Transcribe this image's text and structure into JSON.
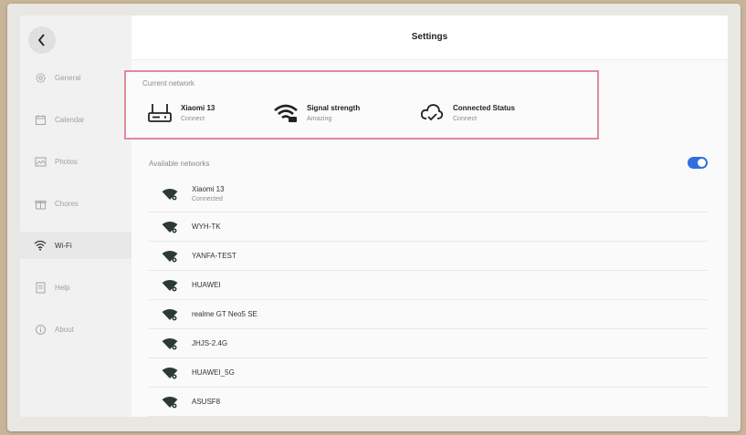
{
  "header": {
    "title": "Settings"
  },
  "sidebar": {
    "items": [
      {
        "label": "General",
        "icon": "gear-icon",
        "active": false
      },
      {
        "label": "Calendar",
        "icon": "calendar-icon",
        "active": false
      },
      {
        "label": "Photos",
        "icon": "photo-icon",
        "active": false
      },
      {
        "label": "Chores",
        "icon": "gift-icon",
        "active": false
      },
      {
        "label": "Wi-Fi",
        "icon": "wifi-icon",
        "active": true
      },
      {
        "label": "Help",
        "icon": "document-icon",
        "active": false
      },
      {
        "label": "About",
        "icon": "info-icon",
        "active": false
      }
    ]
  },
  "current_network": {
    "label": "Current network",
    "items": [
      {
        "title": "Xiaomi 13",
        "subtitle": "Connect",
        "icon": "router-icon"
      },
      {
        "title": "Signal strength",
        "subtitle": "Amazing",
        "icon": "wifi-signal-icon"
      },
      {
        "title": "Connected Status",
        "subtitle": "Connect",
        "icon": "cloud-check-icon"
      }
    ]
  },
  "available": {
    "label": "Available networks",
    "toggle_on": true,
    "networks": [
      {
        "name": "Xiaomi 13",
        "status": "Connected"
      },
      {
        "name": "WYH-TK",
        "status": ""
      },
      {
        "name": "YANFA-TEST",
        "status": ""
      },
      {
        "name": "HUAWEI",
        "status": ""
      },
      {
        "name": "realme GT Neo5 SE",
        "status": ""
      },
      {
        "name": "JHJS-2.4G",
        "status": ""
      },
      {
        "name": "HUAWEI_5G",
        "status": ""
      },
      {
        "name": "ASUSF8",
        "status": ""
      }
    ]
  },
  "colors": {
    "accent": "#2f6fe0",
    "highlight_border": "#e08a9a"
  }
}
